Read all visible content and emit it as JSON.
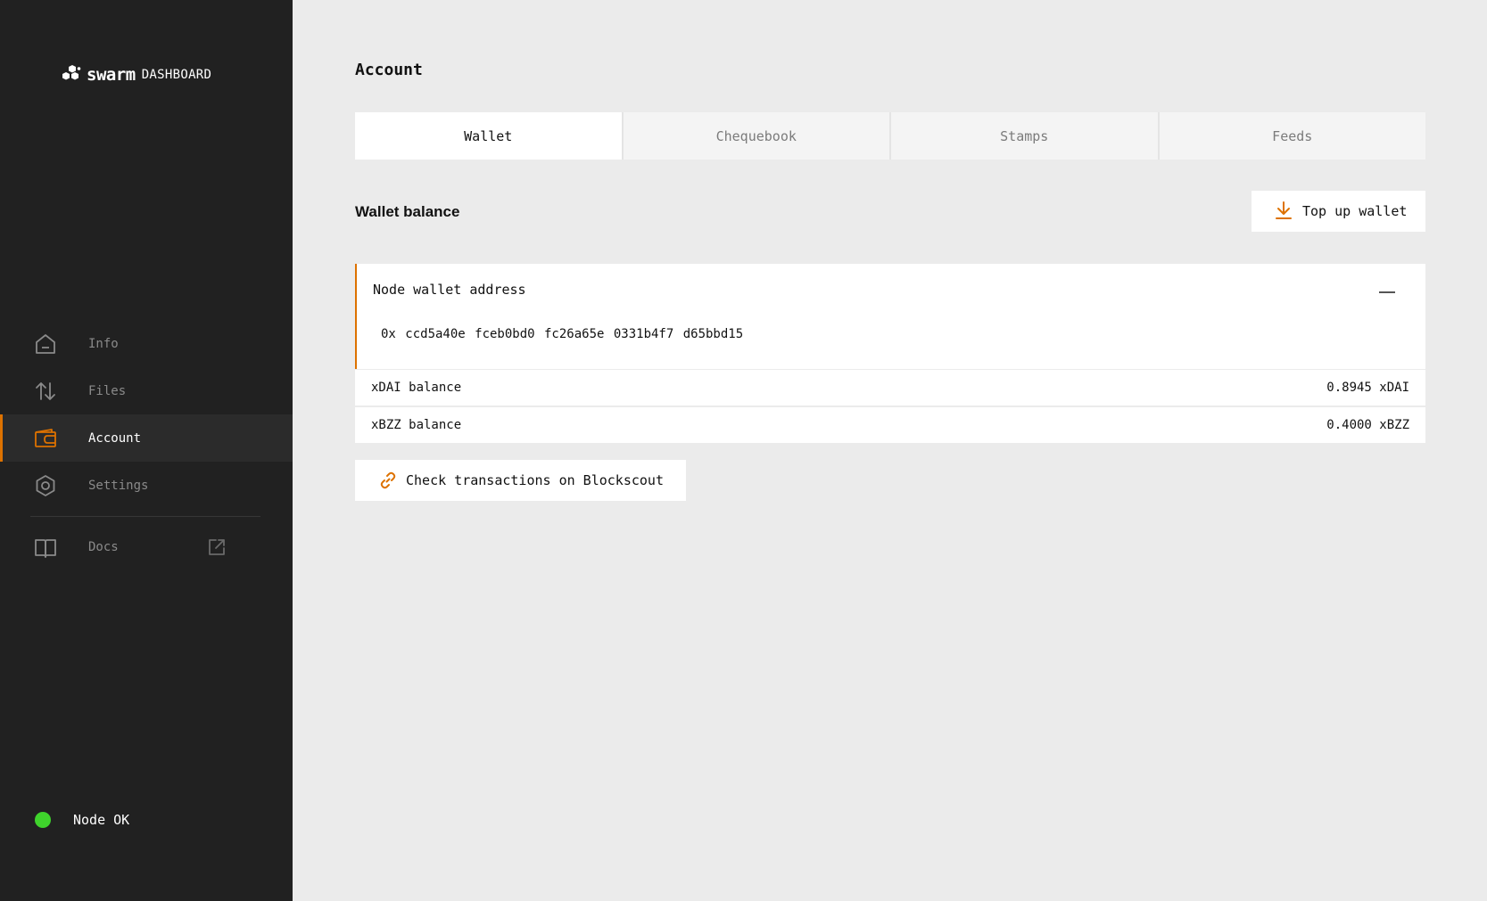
{
  "app": {
    "logo_word": "swarm",
    "logo_sub": "DASHBOARD"
  },
  "sidebar": {
    "items": [
      {
        "label": "Info",
        "icon": "home-icon",
        "active": false
      },
      {
        "label": "Files",
        "icon": "arrows-up-down-icon",
        "active": false
      },
      {
        "label": "Account",
        "icon": "wallet-icon",
        "active": true
      },
      {
        "label": "Settings",
        "icon": "gear-icon",
        "active": false
      }
    ],
    "docs": {
      "label": "Docs",
      "icon": "book-icon",
      "external_icon": "external-link-icon"
    },
    "status": {
      "label": "Node OK",
      "color": "#3fd32c"
    }
  },
  "main": {
    "title": "Account",
    "tabs": [
      {
        "label": "Wallet",
        "active": true
      },
      {
        "label": "Chequebook",
        "active": false
      },
      {
        "label": "Stamps",
        "active": false
      },
      {
        "label": "Feeds",
        "active": false
      }
    ],
    "wallet": {
      "section_title": "Wallet balance",
      "topup_label": "Top up wallet",
      "address_label": "Node wallet address",
      "address_value": "0x ccd5a40e fceb0bd0 fc26a65e 0331b4f7 d65bbd15",
      "balances": [
        {
          "label": "xDAI balance",
          "value": "0.8945 xDAI"
        },
        {
          "label": "xBZZ balance",
          "value": "0.4000 xBZZ"
        }
      ],
      "blockscout_label": "Check transactions on Blockscout"
    }
  },
  "colors": {
    "accent": "#dd7200",
    "sidebar_bg": "#212121",
    "page_bg": "#ebebeb",
    "status_ok": "#3fd32c"
  }
}
